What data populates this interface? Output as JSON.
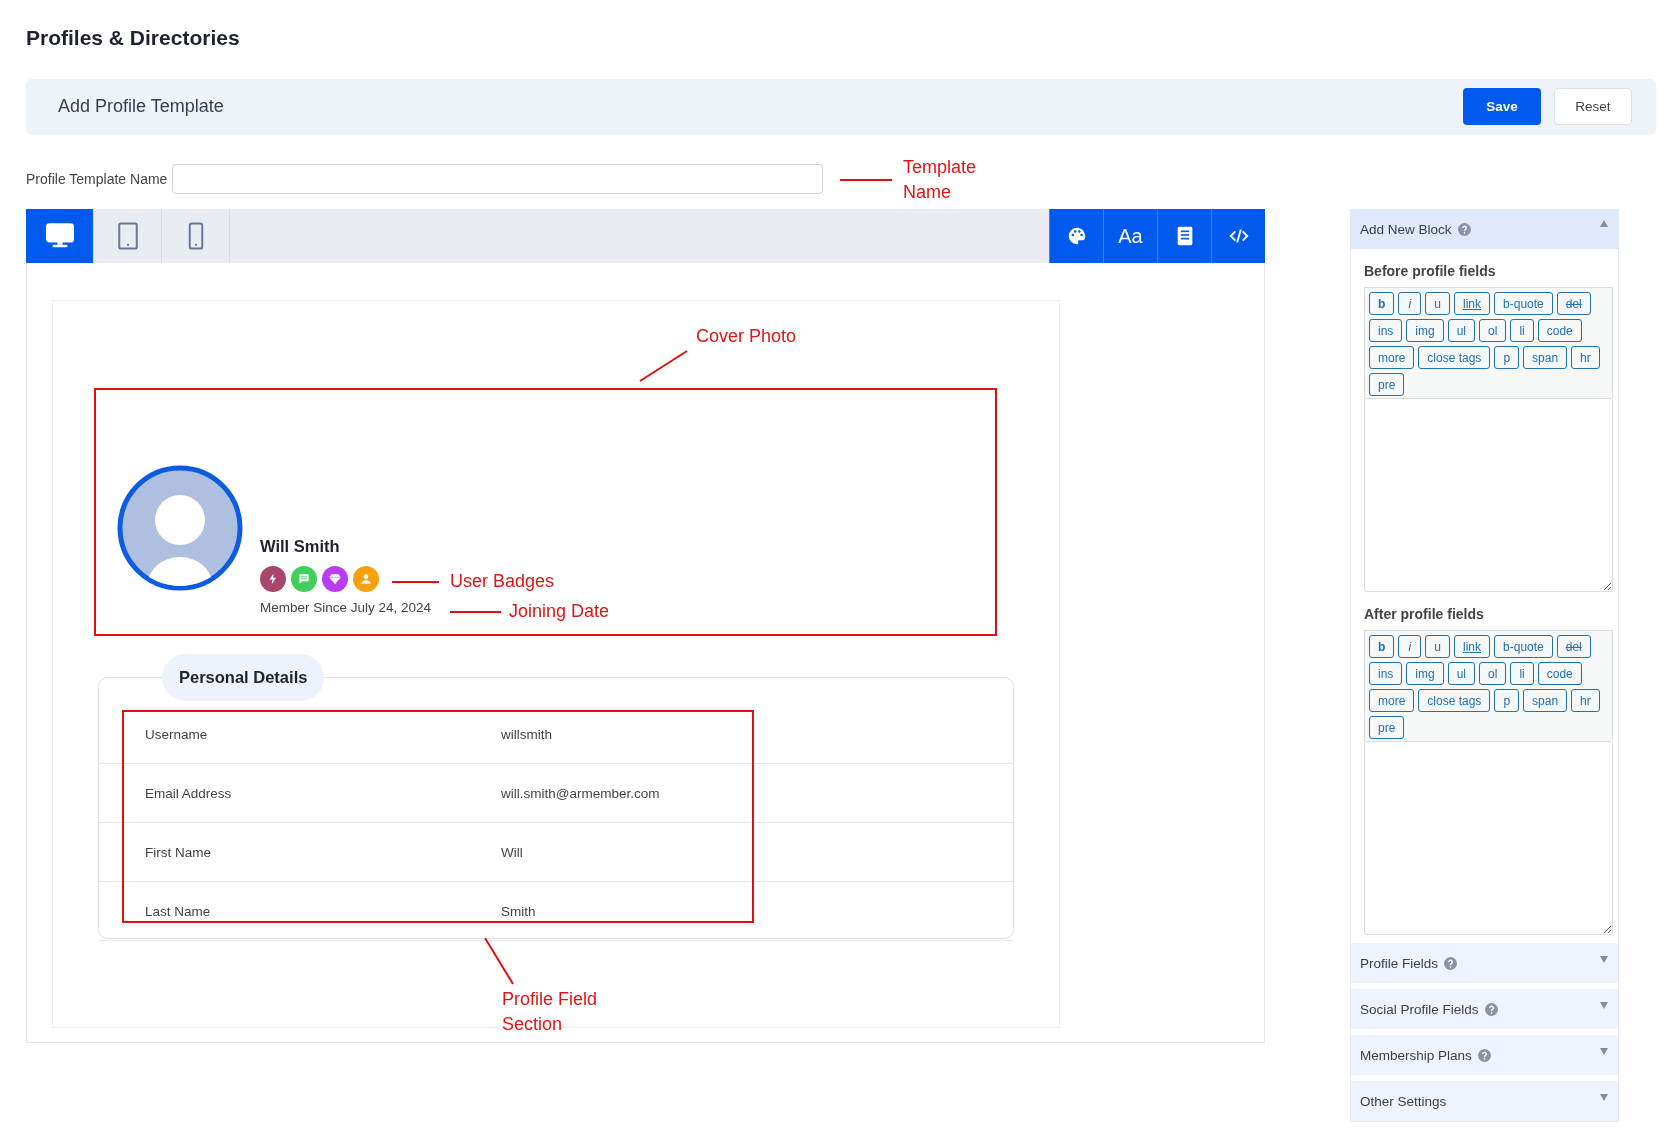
{
  "page_title": "Profiles & Directories",
  "header": {
    "title": "Add Profile Template",
    "buttons": [
      {
        "label": "Save",
        "kind": "primary"
      },
      {
        "label": "Reset",
        "kind": "secondary"
      }
    ]
  },
  "template_name": {
    "label": "Profile Template Name",
    "annotation": "Template Name"
  },
  "device_tabs": [
    {
      "kind": "desktop",
      "selected": true
    },
    {
      "kind": "tablet",
      "selected": false
    },
    {
      "kind": "mobile",
      "selected": false
    }
  ],
  "tool_buttons": [
    {
      "kind": "palette"
    },
    {
      "kind": "typography",
      "label": "Aa"
    },
    {
      "kind": "document"
    },
    {
      "kind": "code"
    }
  ],
  "profile": {
    "name": "Will Smith",
    "cover_annotation": "Cover Photo",
    "badges_annotation": "User Badges",
    "date_annotation": "Joining Date",
    "member_since": "Member Since July 24, 2024",
    "badges": [
      {
        "kind": "bolt",
        "color": "#a8466d"
      },
      {
        "kind": "chat",
        "color": "#3fcf5a"
      },
      {
        "kind": "diamond",
        "color": "#b83cf0"
      },
      {
        "kind": "person",
        "color": "#f8a00e"
      }
    ]
  },
  "personal_details": {
    "title": "Personal Details",
    "annotation": "Profile Field Section",
    "rows": [
      {
        "label": "Username",
        "value": "willsmith"
      },
      {
        "label": "Email Address",
        "value": "will.smith@armember.com"
      },
      {
        "label": "First Name",
        "value": "Will"
      },
      {
        "label": "Last Name",
        "value": "Smith"
      }
    ]
  },
  "sidebar": {
    "header": {
      "title": "Add New Block",
      "help": true,
      "expanded": true
    },
    "editors": [
      {
        "title": "Before profile fields",
        "tags": [
          {
            "label": "b",
            "kind": "bold"
          },
          {
            "label": "i",
            "kind": "italic"
          },
          {
            "label": "u",
            "kind": "plain"
          },
          {
            "label": "link",
            "kind": "link"
          },
          {
            "label": "b-quote",
            "kind": "plain"
          },
          {
            "label": "del",
            "kind": "strike"
          },
          {
            "label": "ins",
            "kind": "plain"
          },
          {
            "label": "img",
            "kind": "plain"
          },
          {
            "label": "ul",
            "kind": "plain"
          },
          {
            "label": "ol",
            "kind": "plain"
          },
          {
            "label": "li",
            "kind": "plain"
          },
          {
            "label": "code",
            "kind": "plain"
          },
          {
            "label": "more",
            "kind": "plain"
          },
          {
            "label": "close tags",
            "kind": "plain"
          },
          {
            "label": "p",
            "kind": "plain"
          },
          {
            "label": "span",
            "kind": "plain"
          },
          {
            "label": "hr",
            "kind": "plain"
          },
          {
            "label": "pre",
            "kind": "plain"
          }
        ]
      },
      {
        "title": "After profile fields",
        "tags": [
          {
            "label": "b",
            "kind": "bold"
          },
          {
            "label": "i",
            "kind": "italic"
          },
          {
            "label": "u",
            "kind": "plain"
          },
          {
            "label": "link",
            "kind": "link"
          },
          {
            "label": "b-quote",
            "kind": "plain"
          },
          {
            "label": "del",
            "kind": "strike"
          },
          {
            "label": "ins",
            "kind": "plain"
          },
          {
            "label": "img",
            "kind": "plain"
          },
          {
            "label": "ul",
            "kind": "plain"
          },
          {
            "label": "ol",
            "kind": "plain"
          },
          {
            "label": "li",
            "kind": "plain"
          },
          {
            "label": "code",
            "kind": "plain"
          },
          {
            "label": "more",
            "kind": "plain"
          },
          {
            "label": "close tags",
            "kind": "plain"
          },
          {
            "label": "p",
            "kind": "plain"
          },
          {
            "label": "span",
            "kind": "plain"
          },
          {
            "label": "hr",
            "kind": "plain"
          },
          {
            "label": "pre",
            "kind": "plain"
          }
        ]
      }
    ],
    "sections": [
      {
        "title": "Profile Fields",
        "help": true,
        "expanded": false
      },
      {
        "title": "Social Profile Fields",
        "help": true,
        "expanded": false
      },
      {
        "title": "Membership Plans",
        "help": true,
        "expanded": false
      },
      {
        "title": "Other Settings",
        "help": false,
        "expanded": false
      }
    ]
  }
}
